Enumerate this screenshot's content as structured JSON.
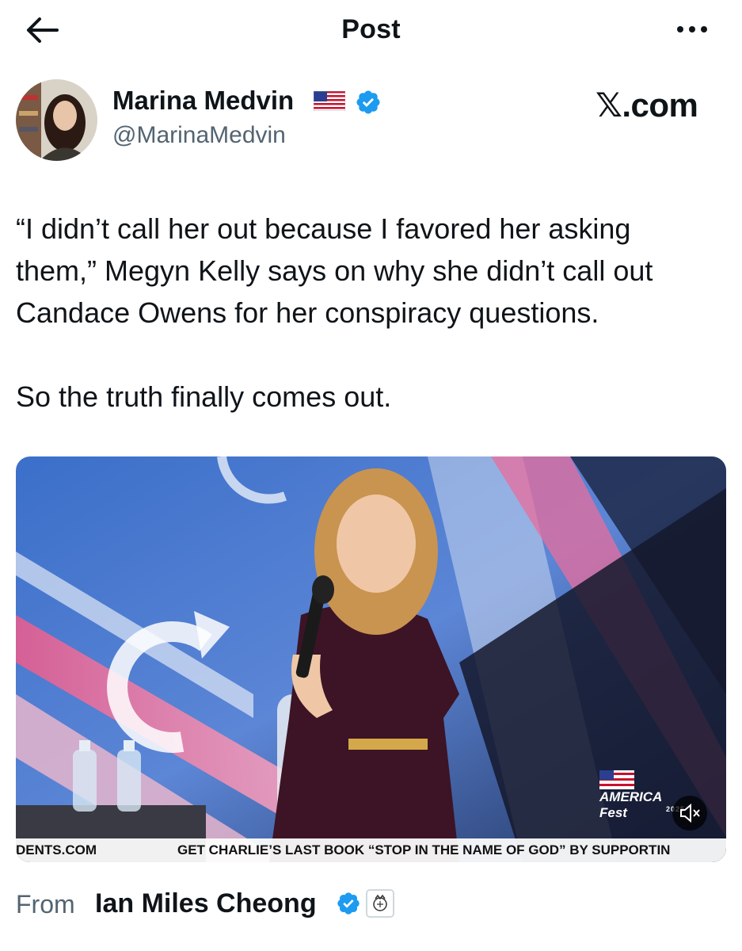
{
  "header": {
    "title": "Post",
    "back_icon": "arrow-left-icon",
    "more_icon": "more-horizontal-icon"
  },
  "author": {
    "name": "Marina Medvin",
    "handle": "@MarinaMedvin",
    "flag_icon": "us-flag-icon",
    "verified_icon": "verified-badge-icon"
  },
  "watermark": "𝕏.com",
  "tweet": {
    "paragraph1_line1": "“I didn’t call her out because I favored her asking",
    "paragraph1_line2": "them,” Megyn Kelly says on why she didn’t call out",
    "paragraph1_line3": "Candace Owens for her conspiracy questions.",
    "paragraph2": "So the truth finally comes out."
  },
  "media": {
    "type": "video",
    "ticker_left": "DENTS.COM",
    "ticker_right": "GET CHARLIE’S LAST BOOK “STOP IN THE NAME OF GOD” BY SUPPORTIN",
    "badge_text": "AMERICA Fest",
    "badge_year": "2025",
    "mute_icon": "volume-muted-icon",
    "colors": {
      "backdrop_blue": "#2f6fd0",
      "backdrop_pink": "#e0508a"
    }
  },
  "footer": {
    "from_label": "From",
    "from_name": "Ian Miles Cheong",
    "verified_icon": "verified-badge-icon",
    "affiliate_icon": "affiliate-badge-icon"
  },
  "colors": {
    "text_primary": "#0f1419",
    "text_secondary": "#536471",
    "verified_blue": "#1d9bf0"
  }
}
